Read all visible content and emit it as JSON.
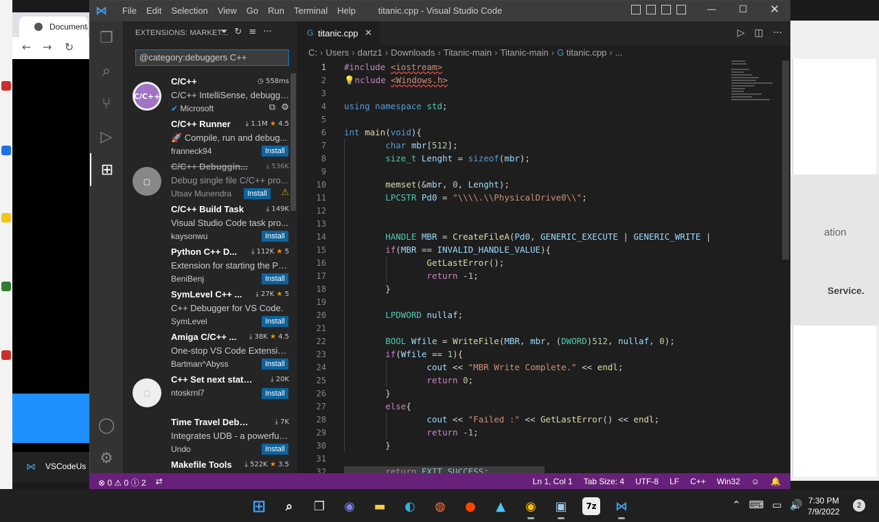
{
  "window": {
    "title": "titanic.cpp - Visual Studio Code",
    "menu": [
      "File",
      "Edit",
      "Selection",
      "View",
      "Go",
      "Run",
      "Terminal",
      "Help"
    ]
  },
  "background": {
    "browser_tab": "Documentati",
    "taskbar_item": "VSCodeUs",
    "right_text_1": "ation",
    "right_text_2": "Service."
  },
  "sidebar": {
    "title": "EXTENSIONS: MARKET...",
    "search_value": "@category:debuggers C++",
    "extensions": [
      {
        "name": "C/C++",
        "stats": "558ms",
        "desc": "C/C++ IntelliSense, debuggi...",
        "publisher": "Microsoft",
        "icon_text": "C/C++",
        "verified": true,
        "installed": true
      },
      {
        "name": "C/C++ Runner",
        "stats": "1.1M",
        "rating": "4.5",
        "desc": "🚀 Compile, run and debug...",
        "publisher": "franneck94",
        "button": "Install"
      },
      {
        "name": "C/C++ Debuggin...",
        "stats": "536K",
        "desc": "Debug single file C/C++ pro...",
        "publisher": "Utsav Munendra",
        "button": "Install",
        "deprecated": true
      },
      {
        "name": "C/C++ Build Task",
        "stats": "149K",
        "desc": "Visual Studio Code task pro...",
        "publisher": "kaysonwu",
        "button": "Install"
      },
      {
        "name": "Python C++ D...",
        "stats": "112K",
        "rating": "5",
        "desc": "Extension for starting the Py...",
        "publisher": "BeniBenj",
        "button": "Install"
      },
      {
        "name": "SymLevel C++ ...",
        "stats": "27K",
        "rating": "5",
        "desc": "C++ Debugger for VS Code.",
        "publisher": "SymLevel",
        "button": "Install"
      },
      {
        "name": "Amiga C/C++ ...",
        "stats": "38K",
        "rating": "4.5",
        "desc": "One-stop VS Code Extensio...",
        "publisher": "Bartman^Abyss",
        "button": "Install"
      },
      {
        "name": "C++ Set next state...",
        "stats": "20K",
        "desc": "",
        "publisher": "ntoskrnl7",
        "button": "Install"
      },
      {
        "name": "Time Travel Debug ...",
        "stats": "7K",
        "desc": "Integrates UDB - a powerful ...",
        "publisher": "Undo",
        "button": "Install"
      },
      {
        "name": "Makefile Tools",
        "stats": "522K",
        "rating": "3.5",
        "desc": "",
        "publisher": ""
      }
    ]
  },
  "editor": {
    "tab": "titanic.cpp",
    "breadcrumb": [
      "C:",
      "Users",
      "dartz1",
      "Downloads",
      "Titanic-main",
      "Titanic-main",
      "titanic.cpp",
      "..."
    ],
    "line_numbers": [
      "1",
      "2",
      "3",
      "4",
      "5",
      "6",
      "7",
      "8",
      "9",
      "10",
      "11",
      "12",
      "13",
      "14",
      "15",
      "16",
      "17",
      "18",
      "19",
      "20",
      "21",
      "22",
      "23",
      "24",
      "25",
      "26",
      "27",
      "28",
      "29",
      "30",
      "31",
      "32"
    ]
  },
  "status": {
    "errors": "0",
    "warnings": "0",
    "info": "2",
    "position": "Ln 1, Col 1",
    "tab_size": "Tab Size: 4",
    "encoding": "UTF-8",
    "eol": "LF",
    "language": "C++",
    "platform": "Win32"
  },
  "taskbar": {
    "time": "7:30 PM",
    "date": "7/9/2022",
    "notifications": "2",
    "icons": [
      "windows-start",
      "search",
      "task-view",
      "teams-chat",
      "file-explorer",
      "edge",
      "firefox",
      "reddit",
      "photos",
      "chrome",
      "installer",
      "7zip",
      "vscode"
    ]
  },
  "colors": {
    "statusbar": "#68217a",
    "accent": "#007fd4",
    "install_button": "#0e639c"
  }
}
